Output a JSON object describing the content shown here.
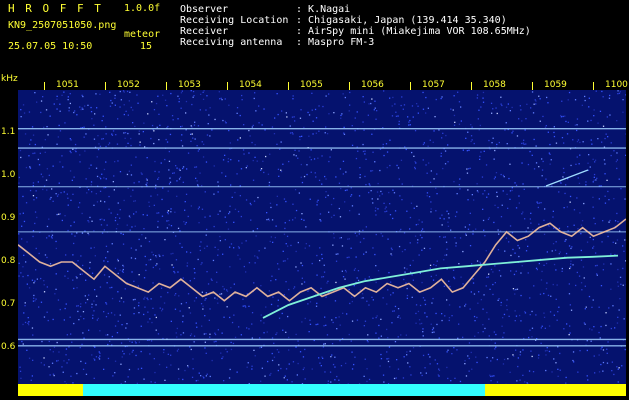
{
  "header": {
    "app_title": "H R O F F T",
    "version": "1.0.0f",
    "filename": "KN9_2507051050.png",
    "mode": "meteor",
    "datetime": "25.07.05 10:50",
    "interval": "15",
    "info": [
      {
        "label": "Observer",
        "value": "K.Nagai"
      },
      {
        "label": "Receiving Location",
        "value": "Chigasaki, Japan (139.414 35.340)"
      },
      {
        "label": "Receiver",
        "value": "AirSpy mini (Miakejima VOR 108.65MHz)"
      },
      {
        "label": "Receiving antenna",
        "value": "Maspro FM-3"
      }
    ]
  },
  "axis": {
    "y_unit": "kHz",
    "y_ticks": [
      "1.1",
      "1.0",
      "0.9",
      "0.8",
      "0.7",
      "0.6"
    ],
    "y_tick_values": [
      1.1,
      1.0,
      0.9,
      0.8,
      0.7,
      0.6
    ],
    "x_ticks": [
      "1051",
      "1052",
      "1053",
      "1054",
      "1055",
      "1056",
      "1057",
      "1058",
      "1059",
      "1100"
    ]
  },
  "colors": {
    "background": "#000000",
    "label_yellow": "#ffff33",
    "spectrum_bg": "#05126e",
    "carrier_line": "#9fd0ff",
    "trace": "#f7c2a0",
    "meteor_trail": "#7ff0d8",
    "signal_bar_yellow": "#ffff00",
    "signal_bar_cyan": "#33ffff"
  },
  "spectrogram": {
    "horizontal_carriers_khz": [
      1.11,
      1.065,
      0.975,
      0.87,
      0.62,
      0.605
    ],
    "wandering_trace_khz": [
      0.84,
      0.82,
      0.8,
      0.79,
      0.8,
      0.8,
      0.78,
      0.76,
      0.79,
      0.77,
      0.75,
      0.74,
      0.73,
      0.75,
      0.74,
      0.76,
      0.74,
      0.72,
      0.73,
      0.71,
      0.73,
      0.72,
      0.74,
      0.72,
      0.73,
      0.71,
      0.73,
      0.74,
      0.72,
      0.73,
      0.74,
      0.72,
      0.74,
      0.73,
      0.75,
      0.74,
      0.75,
      0.73,
      0.74,
      0.76,
      0.73,
      0.74,
      0.77,
      0.8,
      0.84,
      0.87,
      0.85,
      0.86,
      0.88,
      0.89,
      0.87,
      0.86,
      0.88,
      0.86,
      0.87,
      0.88,
      0.9
    ],
    "meteor_trail_khz": [
      0.67,
      0.7,
      0.72,
      0.74,
      0.755,
      0.765,
      0.775,
      0.785,
      0.79,
      0.795,
      0.8,
      0.805,
      0.81,
      0.812,
      0.815
    ]
  }
}
